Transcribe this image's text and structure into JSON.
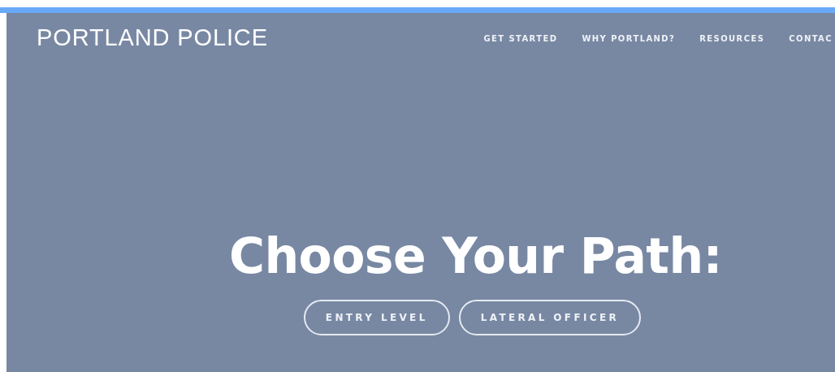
{
  "header": {
    "logo": "PORTLAND POLICE",
    "nav": [
      {
        "label": "GET STARTED"
      },
      {
        "label": "WHY PORTLAND?"
      },
      {
        "label": "RESOURCES"
      },
      {
        "label": "CONTAC"
      }
    ]
  },
  "hero": {
    "title": "Choose Your Path:",
    "buttons": [
      {
        "label": "ENTRY LEVEL"
      },
      {
        "label": "LATERAL OFFICER"
      }
    ]
  }
}
